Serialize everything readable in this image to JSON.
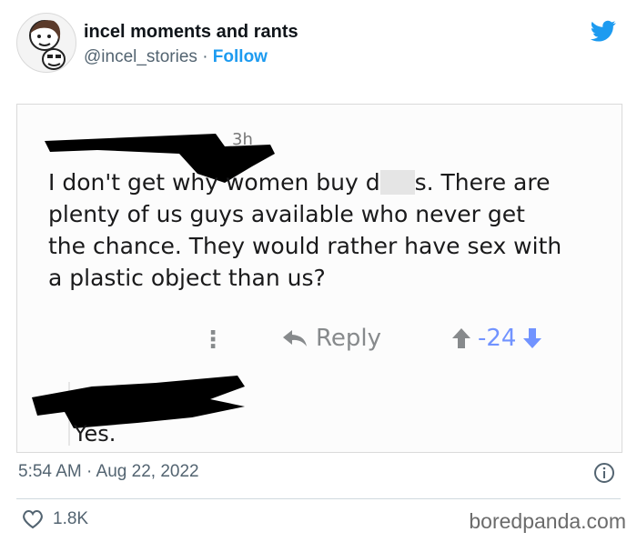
{
  "account": {
    "name": "incel moments and rants",
    "handle": "@incel_stories",
    "separator": "·",
    "follow_label": "Follow"
  },
  "icons": {
    "twitter_logo": "twitter-bird-icon",
    "reply": "reply-arrow-icon",
    "upvote": "arrow-up-icon",
    "downvote": "arrow-down-icon",
    "more": "more-vertical-icon",
    "info": "info-icon",
    "like": "heart-icon"
  },
  "embed": {
    "post": {
      "time": "3h",
      "text_before_redaction": "I don't get why women buy d",
      "text_after_redaction": "s. There are\nplenty of us guys available who never get\nthe chance. They would rather have sex with\na plastic object than us?",
      "more_dots": "⋮",
      "reply_label": "Reply",
      "score": "-24"
    },
    "reply": {
      "text": "Yes."
    }
  },
  "tweet": {
    "timestamp": "5:54 AM · Aug 22, 2022",
    "likes": "1.8K"
  },
  "watermark": "boredpanda.com",
  "colors": {
    "twitter_blue": "#1d9bf0",
    "secondary_text": "#536471",
    "downvote_blue": "#7193ff",
    "action_gray": "#878a8c"
  }
}
